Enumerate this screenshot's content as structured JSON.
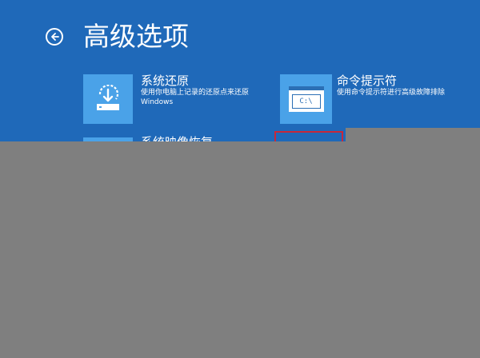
{
  "header": {
    "title": "高级选项",
    "back_icon": "back-arrow-icon"
  },
  "options": [
    {
      "title": "系统还原",
      "description": "使用你电脑上记录的还原点来还原 Windows",
      "icon": "system-restore-icon"
    },
    {
      "title": "命令提示符",
      "description": "使用命令提示符进行高级故障排除",
      "icon": "command-prompt-icon",
      "icon_text": "C:\\"
    },
    {
      "title": "系统映像恢复",
      "icon": "system-image-icon"
    }
  ],
  "colors": {
    "background": "#1f69b9",
    "tile": "#4aa2e8",
    "overlay": "#7f7f7f",
    "highlight": "#c8283a"
  }
}
